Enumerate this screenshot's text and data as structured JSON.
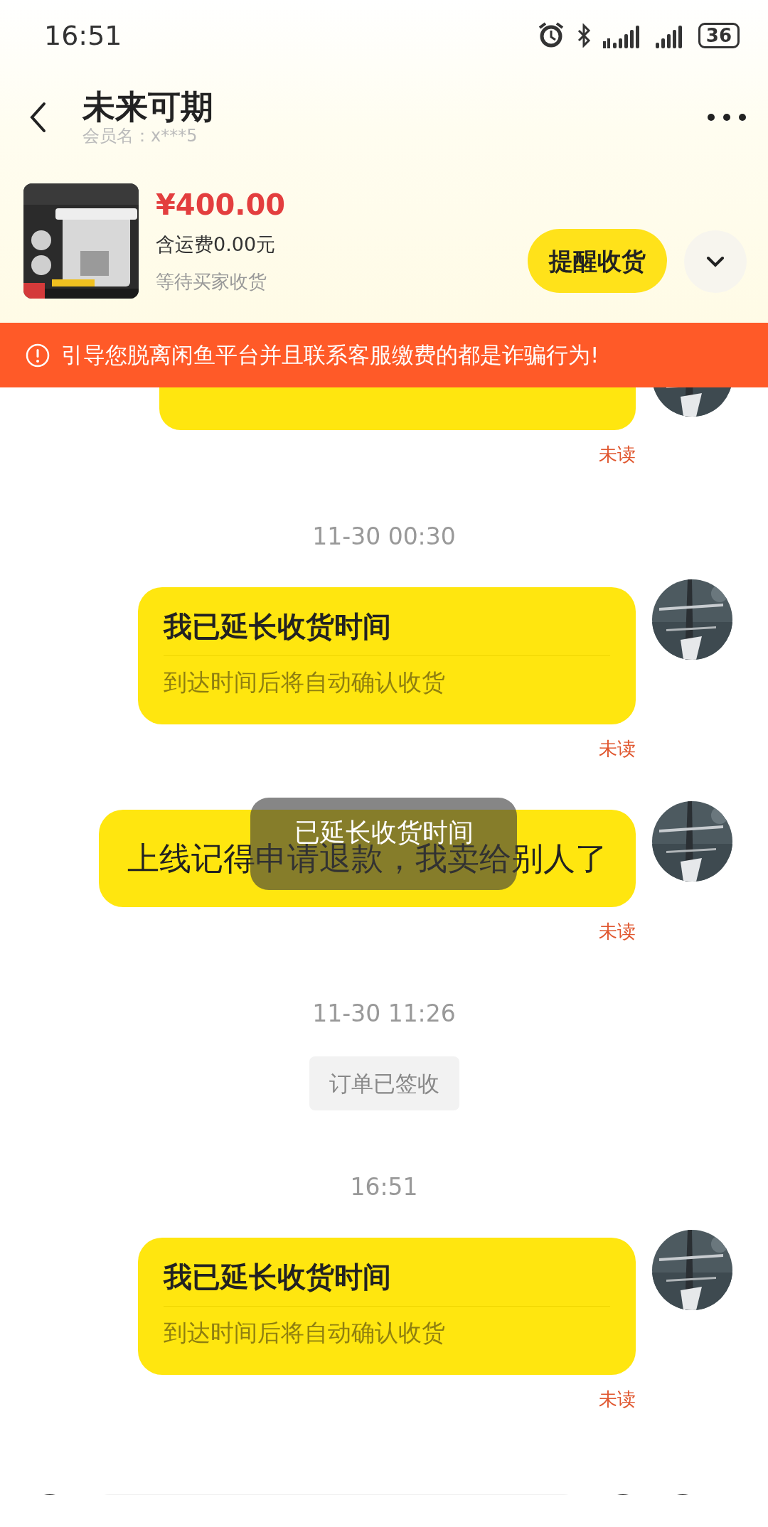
{
  "status_bar": {
    "time": "16:51",
    "battery": "36"
  },
  "header": {
    "title": "未来可期",
    "subtitle": "会员名：x***5"
  },
  "order": {
    "price": "¥400.00",
    "shipping": "含运费0.00元",
    "status": "等待买家收货",
    "action": "提醒收货"
  },
  "warning": {
    "text": "引导您脱离闲鱼平台并且联系客服缴费的都是诈骗行为!"
  },
  "messages": [
    {
      "kind": "clipped",
      "read_status": "未读"
    },
    {
      "kind": "timestamp",
      "text": "11-30 00:30"
    },
    {
      "kind": "card",
      "title": "我已延长收货时间",
      "subtitle": "到达时间后将自动确认收货",
      "read_status": "未读"
    },
    {
      "kind": "text",
      "text": "上线记得申请退款，我卖给别人了",
      "read_status": "未读",
      "toast": "已延长收货时间"
    },
    {
      "kind": "timestamp",
      "text": "11-30 11:26"
    },
    {
      "kind": "system",
      "text": "订单已签收"
    },
    {
      "kind": "timestamp",
      "text": "16:51"
    },
    {
      "kind": "card",
      "title": "我已延长收货时间",
      "subtitle": "到达时间后将自动确认收货",
      "read_status": "未读"
    }
  ]
}
